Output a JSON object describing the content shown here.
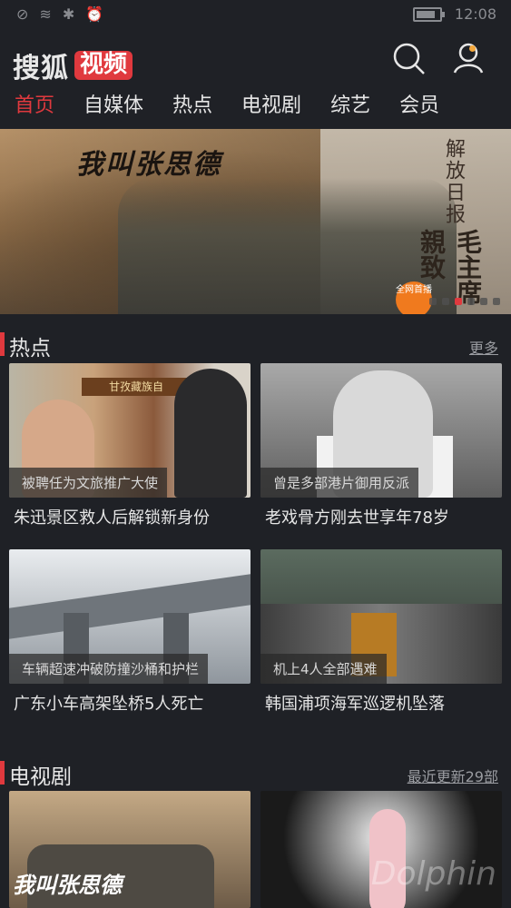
{
  "status": {
    "time": "12:08",
    "battery_percent": 85
  },
  "header": {
    "logo_text": "搜狐",
    "logo_badge": "视频"
  },
  "tabs": [
    {
      "label": "首页",
      "active": true
    },
    {
      "label": "自媒体"
    },
    {
      "label": "热点"
    },
    {
      "label": "电视剧"
    },
    {
      "label": "综艺"
    },
    {
      "label": "会员"
    }
  ],
  "banner": {
    "title": "我叫张思德",
    "paper_text": "解放日报",
    "paper_vertical": "毛主席親致",
    "badge": "全网首播",
    "page_indicator": {
      "total": 6,
      "active": 2
    }
  },
  "hot": {
    "title": "热点",
    "more": "更多",
    "items": [
      {
        "caption": "被聘任为文旅推广大使",
        "title": "朱迅景区救人后解锁新身份",
        "sign": "甘孜藏族自"
      },
      {
        "caption": "曾是多部港片御用反派",
        "title": "老戏骨方刚去世享年78岁"
      },
      {
        "caption": "车辆超速冲破防撞沙桶和护栏",
        "title": "广东小车高架坠桥5人死亡"
      },
      {
        "caption": "机上4人全部遇难",
        "title": "韩国浦项海军巡逻机坠落"
      }
    ]
  },
  "tv": {
    "title": "电视剧",
    "more": "最近更新29部",
    "items": [
      {
        "overlay_text": "我叫张思德"
      },
      {
        "overlay_text": ""
      }
    ]
  },
  "watermark": "Dolphin"
}
